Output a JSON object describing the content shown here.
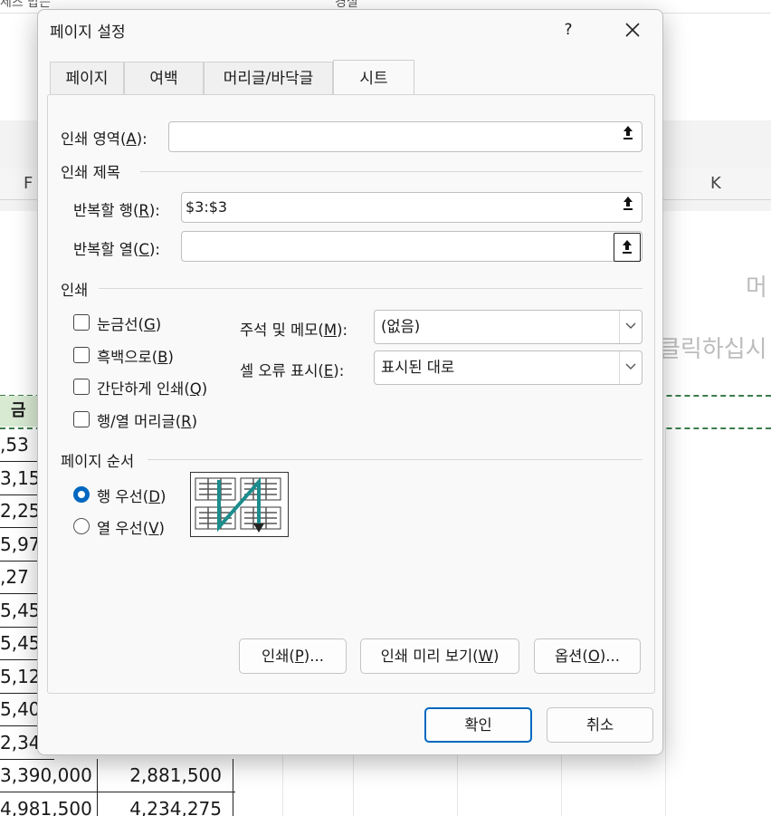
{
  "background": {
    "top_texts": [
      "세즈 맙는",
      "경실"
    ],
    "col_headers": [
      "F",
      "K"
    ],
    "right_texts": [
      "머",
      "클릭하십시"
    ],
    "header_cell": "금",
    "partial_rows": [
      ",53",
      "3,15",
      "2,25",
      "5,97",
      ",27",
      "5,45",
      "5,45",
      "5,12",
      "5,40",
      "2,34"
    ],
    "full_rows": [
      {
        "c1": "3,390,000",
        "c2": "2,881,500"
      },
      {
        "c1": "4,981,500",
        "c2": "4,234,275"
      }
    ]
  },
  "dialog": {
    "title": "페이지 설정",
    "help": "?",
    "close": "✕",
    "tabs": [
      "페이지",
      "여백",
      "머리글/바닥글",
      "시트"
    ],
    "active_tab": "시트",
    "print_area": {
      "label": "인쇄 영역(",
      "key": "A",
      "tail": "):",
      "value": ""
    },
    "print_titles": {
      "group": "인쇄 제목",
      "rows": {
        "label": "반복할 행(",
        "key": "R",
        "tail": "):",
        "value": "$3:$3"
      },
      "cols": {
        "label": "반복할 열(",
        "key": "C",
        "tail": "):",
        "value": ""
      }
    },
    "print": {
      "group": "인쇄",
      "checkboxes": [
        {
          "label": "눈금선(",
          "key": "G",
          "tail": ")",
          "checked": false
        },
        {
          "label": "흑백으로(",
          "key": "B",
          "tail": ")",
          "checked": false
        },
        {
          "label": "간단하게 인쇄(",
          "key": "Q",
          "tail": ")",
          "checked": false
        },
        {
          "label": "행/열 머리글(",
          "key": "R",
          "tail": ")",
          "checked": false
        }
      ],
      "comments": {
        "label": "주석 및 메모(",
        "key": "M",
        "tail": "):",
        "value": "(없음)"
      },
      "errors": {
        "label": "셀 오류 표시(",
        "key": "E",
        "tail": "):",
        "value": "표시된 대로"
      }
    },
    "page_order": {
      "group": "페이지 순서",
      "options": [
        {
          "label": "행 우선(",
          "key": "D",
          "tail": ")",
          "selected": true
        },
        {
          "label": "열 우선(",
          "key": "V",
          "tail": ")",
          "selected": false
        }
      ]
    },
    "buttons": {
      "print": {
        "pre": "인쇄(",
        "key": "P",
        "tail": ")..."
      },
      "preview": {
        "pre": "인쇄 미리 보기(",
        "key": "W",
        "tail": ")"
      },
      "options": {
        "pre": "옵션(",
        "key": "O",
        "tail": ")..."
      },
      "ok": "확인",
      "cancel": "취소"
    },
    "colors": {
      "accent": "#0067c0",
      "order_arrow": "#1c8c8c"
    }
  }
}
